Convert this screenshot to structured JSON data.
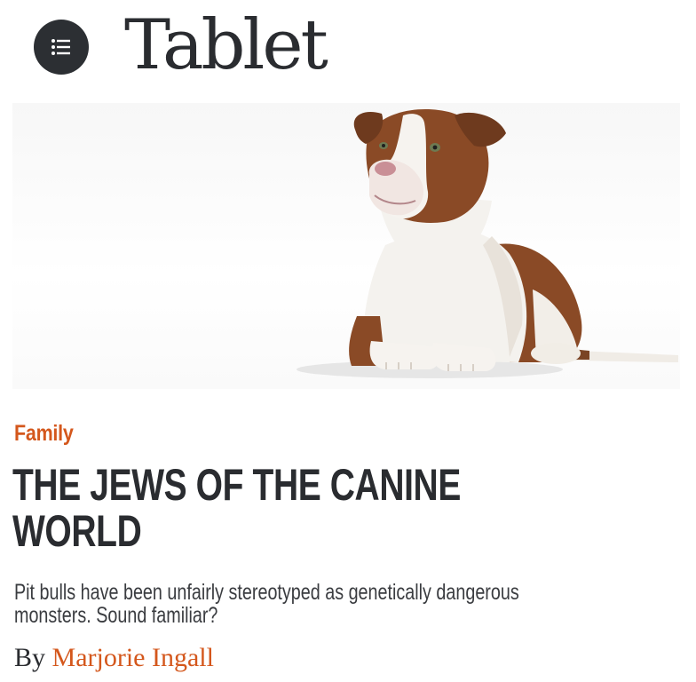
{
  "header": {
    "logo": "Tablet",
    "menu_icon": "menu-list-icon"
  },
  "hero": {
    "image": "pit-bull-dog-photo",
    "colors": {
      "background": "#f7f7f7",
      "fur_brown": "#8a4a26",
      "fur_white": "#f4f2ee"
    }
  },
  "article": {
    "category": "Family",
    "headline_line1": "THE JEWS OF THE CANINE",
    "headline_line2": "WORLD",
    "dek_line1": "Pit bulls have been unfairly stereotyped as genetically dangerous",
    "dek_line2": "monsters. Sound familiar?",
    "byline_prefix": "By",
    "author": "Marjorie Ingall"
  },
  "colors": {
    "accent": "#d4571c",
    "text": "#2a2c30"
  }
}
